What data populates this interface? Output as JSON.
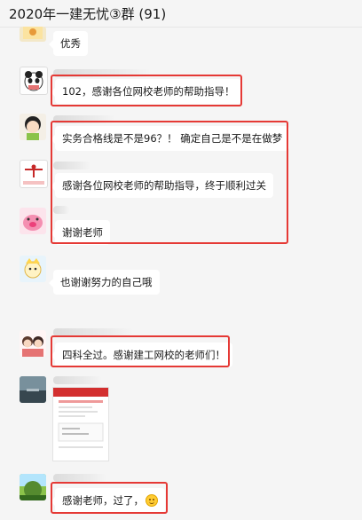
{
  "window": {
    "title": "2020年一建无忧③群 (91)"
  },
  "messages": [
    {
      "text": "优秀",
      "avatar": "sticker-avatar"
    },
    {
      "text": "102，感谢各位网校老师的帮助指导！",
      "avatar": "panda-avatar"
    },
    {
      "text": "实务合格线是不是96？！ 确定自己是不是在做梦",
      "avatar": "girl-cartoon-avatar"
    },
    {
      "text": "感谢各位网校老师的帮助指导，终于顺利过关",
      "avatar": "gymnast-avatar"
    },
    {
      "text": "谢谢老师",
      "avatar": "pink-pig-avatar"
    },
    {
      "text": "也谢谢努力的自己哦",
      "avatar": "cartoon-avatar"
    },
    {
      "text": "四科全过。感谢建工网校的老师们！",
      "avatar": "couple-avatar"
    },
    {
      "text": "",
      "avatar": "lake-avatar",
      "image": "score-report-screenshot"
    },
    {
      "text": "感谢老师，过了，",
      "avatar": "landscape-avatar",
      "emoji": "smile-emoji"
    }
  ],
  "colors": {
    "highlight": "#e53935",
    "bubble": "#ffffff",
    "background": "#f5f5f5"
  }
}
